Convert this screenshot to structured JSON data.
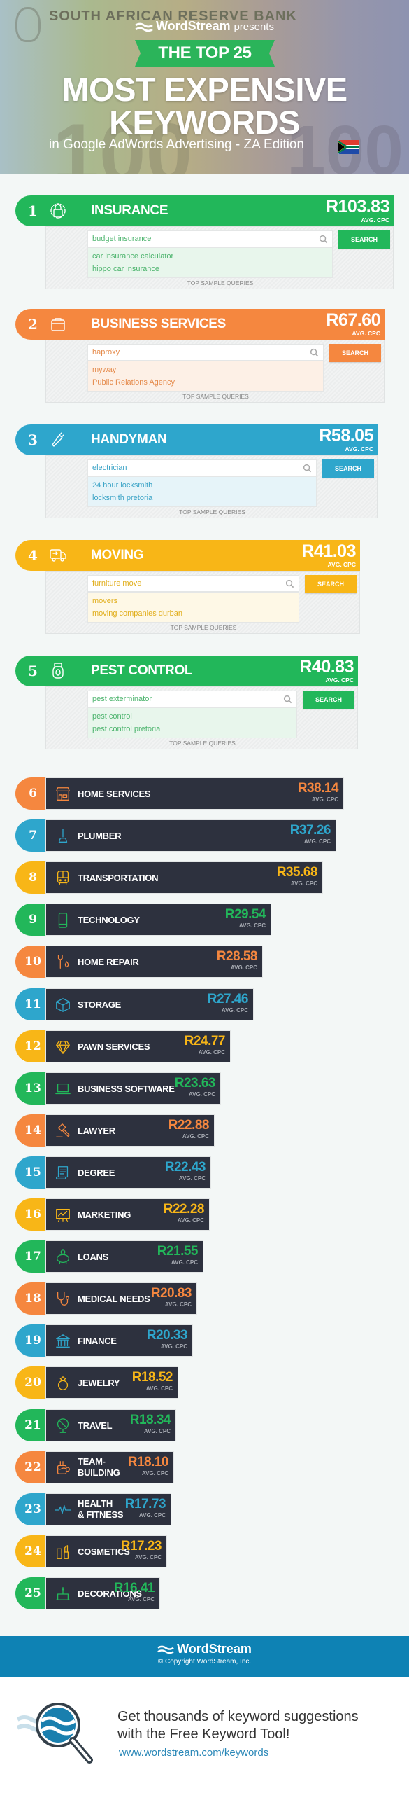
{
  "header": {
    "banknote_text": "SOUTH AFRICAN RESERVE BANK",
    "banknote_denomination": "100",
    "brand": "WordStream",
    "presents": "presents",
    "ribbon": "THE TOP 25",
    "title_line1": "MOST EXPENSIVE",
    "title_line2": "KEYWORDS",
    "subtitle": "in Google AdWords Advertising - ZA Edition",
    "flag": "south-africa-flag-icon"
  },
  "colors": {
    "green": "#22b75a",
    "orange": "#f5873f",
    "blue": "#2ea6cc",
    "yellow": "#f8b617",
    "dark_bar": "#2d313e",
    "footer_blue": "#0e82b4"
  },
  "labels": {
    "avg_cpc": "AVG. CPC",
    "search_button": "SEARCH",
    "top_sample_queries": "TOP SAMPLE QUERIES"
  },
  "chart_data": {
    "type": "bar",
    "title": "The Top 25 Most Expensive Keywords in Google AdWords Advertising - ZA Edition",
    "xlabel": "",
    "ylabel": "Avg. CPC (R)",
    "orientation": "horizontal",
    "currency": "R",
    "categories": [
      "INSURANCE",
      "BUSINESS SERVICES",
      "HANDYMAN",
      "MOVING",
      "PEST CONTROL",
      "HOME SERVICES",
      "PLUMBER",
      "TRANSPORTATION",
      "TECHNOLOGY",
      "HOME REPAIR",
      "STORAGE",
      "PAWN SERVICES",
      "BUSINESS SOFTWARE",
      "LAWYER",
      "DEGREE",
      "MARKETING",
      "LOANS",
      "MEDICAL NEEDS",
      "FINANCE",
      "JEWELRY",
      "TRAVEL",
      "TEAM-BUILDING",
      "HEALTH & FITNESS",
      "COSMETICS",
      "DECORATIONS"
    ],
    "values": [
      103.83,
      67.6,
      58.05,
      41.03,
      40.83,
      38.14,
      37.26,
      35.68,
      29.54,
      28.58,
      27.46,
      24.77,
      23.63,
      22.88,
      22.43,
      22.28,
      21.55,
      20.83,
      20.33,
      18.52,
      18.34,
      18.1,
      17.73,
      17.23,
      16.41
    ],
    "value_labels": [
      "R103.83",
      "R67.60",
      "R58.05",
      "R41.03",
      "R40.83",
      "R38.14",
      "R37.26",
      "R35.68",
      "R29.54",
      "R28.58",
      "R27.46",
      "R24.77",
      "R23.63",
      "R22.88",
      "R22.43",
      "R22.28",
      "R21.55",
      "R20.83",
      "R20.33",
      "R18.52",
      "R18.34",
      "R18.10",
      "R17.73",
      "R17.23",
      "R16.41"
    ],
    "grid": false,
    "legend": "none"
  },
  "top5": [
    {
      "rank": "1",
      "name": "INSURANCE",
      "value": "R103.83",
      "color": "green",
      "icon": "lock-icon",
      "query": "budget insurance",
      "suggestions": [
        "car insurance calculator",
        "hippo car insurance"
      ]
    },
    {
      "rank": "2",
      "name": "BUSINESS SERVICES",
      "value": "R67.60",
      "color": "orange",
      "icon": "briefcase-icon",
      "query": "haproxy",
      "suggestions": [
        "myway",
        "Public Relations Agency"
      ]
    },
    {
      "rank": "3",
      "name": "HANDYMAN",
      "value": "R58.05",
      "color": "blue",
      "icon": "wrench-icon",
      "query": "electrician",
      "suggestions": [
        "24 hour locksmith",
        "locksmith pretoria"
      ]
    },
    {
      "rank": "4",
      "name": "MOVING",
      "value": "R41.03",
      "color": "yellow",
      "icon": "moving-van-icon",
      "query": "furniture move",
      "suggestions": [
        "movers",
        "moving companies durban"
      ]
    },
    {
      "rank": "5",
      "name": "PEST CONTROL",
      "value": "R40.83",
      "color": "green",
      "icon": "bug-spray-icon",
      "query": "pest exterminator",
      "suggestions": [
        "pest control",
        "pest control pretoria"
      ]
    }
  ],
  "rows": [
    {
      "rank": "6",
      "name": "HOME SERVICES",
      "value": "R38.14",
      "color": "orange",
      "icon": "storefront-icon"
    },
    {
      "rank": "7",
      "name": "PLUMBER",
      "value": "R37.26",
      "color": "blue",
      "icon": "plunger-icon"
    },
    {
      "rank": "8",
      "name": "TRANSPORTATION",
      "value": "R35.68",
      "color": "yellow",
      "icon": "bus-icon"
    },
    {
      "rank": "9",
      "name": "TECHNOLOGY",
      "value": "R29.54",
      "color": "green",
      "icon": "smartphone-icon"
    },
    {
      "rank": "10",
      "name": "HOME REPAIR",
      "value": "R28.58",
      "color": "orange",
      "icon": "wrench-drop-icon"
    },
    {
      "rank": "11",
      "name": "STORAGE",
      "value": "R27.46",
      "color": "blue",
      "icon": "box-icon"
    },
    {
      "rank": "12",
      "name": "PAWN SERVICES",
      "value": "R24.77",
      "color": "yellow",
      "icon": "diamond-icon"
    },
    {
      "rank": "13",
      "name": "BUSINESS SOFTWARE",
      "value": "R23.63",
      "color": "green",
      "icon": "laptop-icon"
    },
    {
      "rank": "14",
      "name": "LAWYER",
      "value": "R22.88",
      "color": "orange",
      "icon": "gavel-icon"
    },
    {
      "rank": "15",
      "name": "DEGREE",
      "value": "R22.43",
      "color": "blue",
      "icon": "diploma-scroll-icon"
    },
    {
      "rank": "16",
      "name": "MARKETING",
      "value": "R22.28",
      "color": "yellow",
      "icon": "presentation-chart-icon"
    },
    {
      "rank": "17",
      "name": "LOANS",
      "value": "R21.55",
      "color": "green",
      "icon": "piggy-bank-icon"
    },
    {
      "rank": "18",
      "name": "MEDICAL NEEDS",
      "value": "R20.83",
      "color": "orange",
      "icon": "stethoscope-icon"
    },
    {
      "rank": "19",
      "name": "FINANCE",
      "value": "R20.33",
      "color": "blue",
      "icon": "bank-building-icon"
    },
    {
      "rank": "20",
      "name": "JEWELRY",
      "value": "R18.52",
      "color": "yellow",
      "icon": "ring-icon"
    },
    {
      "rank": "21",
      "name": "TRAVEL",
      "value": "R18.34",
      "color": "green",
      "icon": "globe-icon"
    },
    {
      "rank": "22",
      "name": "TEAM-\nBUILDING",
      "value": "R18.10",
      "color": "orange",
      "icon": "coffee-mug-icon"
    },
    {
      "rank": "23",
      "name": "HEALTH\n& FITNESS",
      "value": "R17.73",
      "color": "blue",
      "icon": "heartbeat-icon"
    },
    {
      "rank": "24",
      "name": "COSMETICS",
      "value": "R17.23",
      "color": "yellow",
      "icon": "lipstick-icon"
    },
    {
      "rank": "25",
      "name": "DECORATIONS",
      "value": "R16.41",
      "color": "green",
      "icon": "candle-cake-icon"
    }
  ],
  "footer": {
    "brand": "WordStream",
    "copyright": "© Copyright WordStream, Inc."
  },
  "promo": {
    "line1": "Get thousands of keyword suggestions",
    "line2": "with the Free Keyword Tool!",
    "url": "www.wordstream.com/keywords"
  }
}
